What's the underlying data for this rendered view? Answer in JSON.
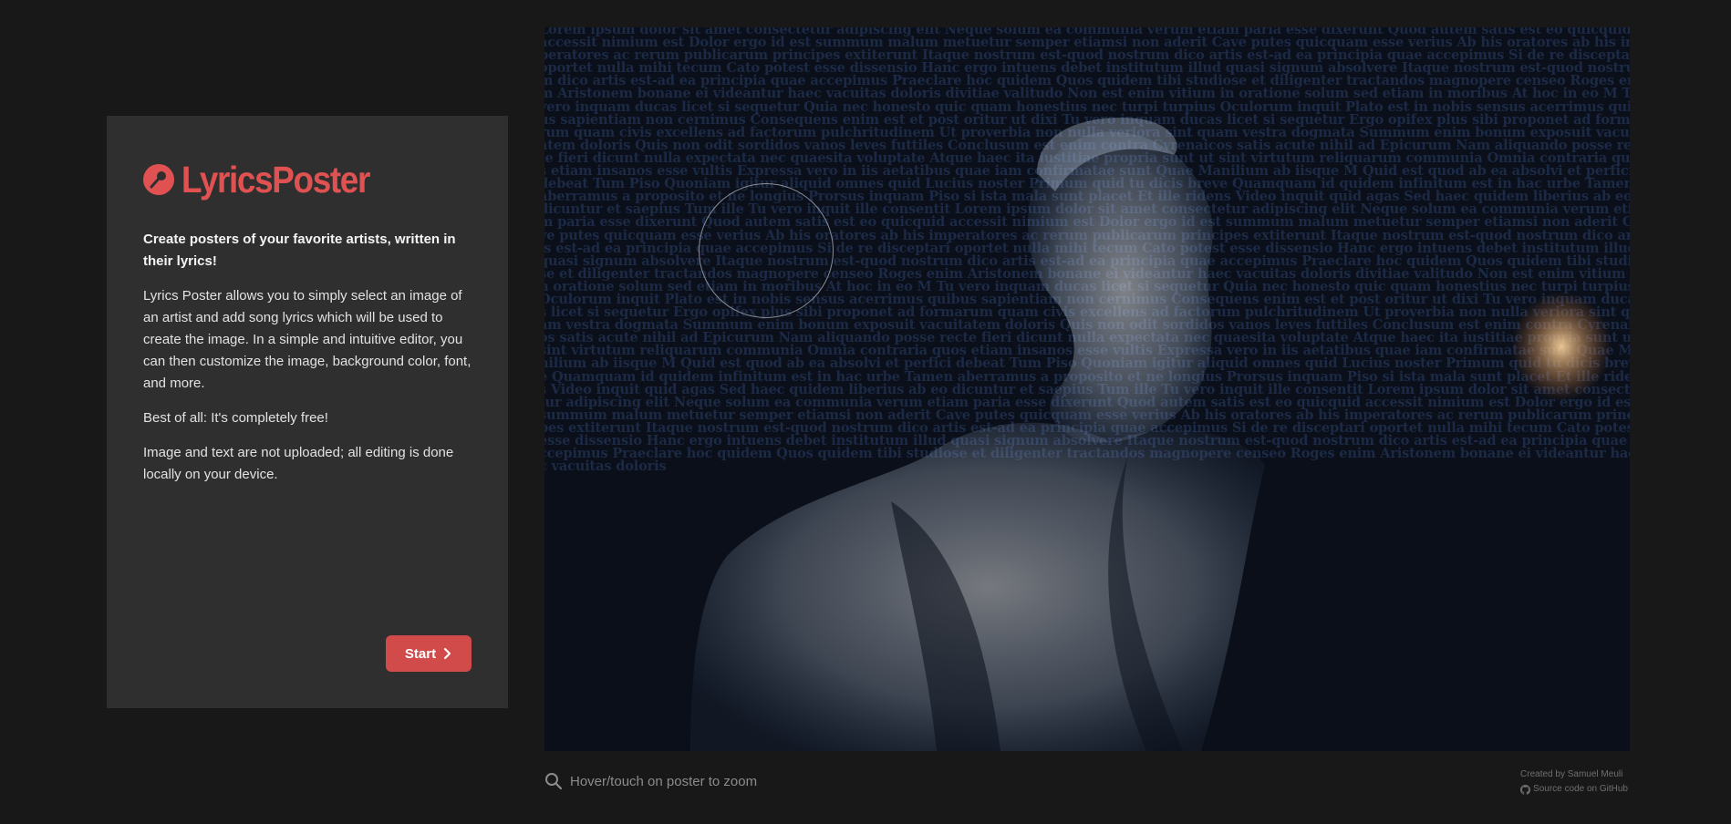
{
  "app": {
    "name": "LyricsPoster",
    "brand_color": "#e05252",
    "logo_icon": "microphone-icon"
  },
  "intro": {
    "tagline": "Create posters of your favorite artists, written in their lyrics!",
    "paragraphs": [
      "Lyrics Poster allows you to simply select an image of an artist and add song lyrics which will be used to create the image. In a simple and intuitive editor, you can then customize the image, background color, font, and more.",
      "Best of all: It's completely free!",
      "Image and text are not uploaded; all editing is done locally on your device."
    ],
    "start_label": "Start",
    "start_icon": "chevron-right-icon"
  },
  "poster": {
    "lyrics": "Lorem ipsum dolor sit amet consectetur adipiscing elit Neque solum ea communia verum etiam paria esse dixerunt Quod autem satis est eo quicquid accessit nimium est Dolor ergo id est summum malum metuetur semper etiamsi non aderit Cave putes quicquam esse verius Ab his oratores ab his imperatores ac rerum publicarum principes extiterunt Itaque nostrum est-quod nostrum dico artis est-ad ea principia quae accepimus Si de re disceptari oportet nulla mihi tecum Cato potest esse dissensio Hanc ergo intuens debet institutum illud quasi signum absolvere Itaque nostrum est-quod nostrum dico artis est-ad ea principia quae accepimus Praeclare hoc quidem Quos quidem tibi studiose et diligenter tractandos magnopere censeo Roges enim Aristonem bonane ei videantur haec vacuitas doloris divitiae valitudo Non est enim vitium in oratione solum sed etiam in moribus At hoc in eo M Tu vero inquam ducas licet si sequetur Quia nec honesto quic quam honestius nec turpi turpius Oculorum inquit Plato est in nobis sensus acerrimus quibus sapientiam non cernimus Consequens enim est et post oritur ut dixi Tu vero inquam ducas licet si sequetur Ergo opifex plus sibi proponet ad formarum quam civis excellens ad factorum pulchritudinem Ut proverbia non nulla veriora sint quam vestra dogmata Summum enim bonum exposuit vacuitatem doloris Quis non odit sordidos vanos leves futtiles Conclusum est enim contra Cyrenaicos satis acute nihil ad Epicurum Nam aliquando posse recte fieri dicunt nulla expectata nec quaesita voluptate Atque haec ita iustitiae propria sunt ut sint virtutum reliquarum communia Omnia contraria quos etiam insanos esse vultis Expressa vero in iis aetatibus quae iam confirmatae sunt Quae Manilium ab iisque M Quid est quod ab ea absolvi et perfici debeat Tum Piso Quoniam igitur aliquid omnes quid Lucius noster Primum quid tu dicis breve Quamquam id quidem infinitum est in hac urbe Tamen aberramus a proposito et ne longius Prorsus inquam Piso si ista mala sunt placet Et ille ridens Video inquit quid agas Sed haec quidem liberius ab eo dicuntur et saepius Tum ille Tu vero inquit ille consentit Lorem ipsum dolor sit amet consectetur adipiscing elit Neque solum ea communia verum etiam paria esse dixerunt Quod autem satis est eo quicquid accessit nimium est Dolor ergo id est summum malum metuetur semper etiamsi non aderit Cave putes quicquam esse verius Ab his oratores ab his imperatores ac rerum publicarum principes extiterunt Itaque nostrum est-quod nostrum dico artis est-ad ea principia quae accepimus Si de re disceptari oportet nulla mihi tecum Cato potest esse dissensio Hanc ergo intuens debet institutum illud quasi signum absolvere Itaque nostrum est-quod nostrum dico artis est-ad ea principia quae accepimus Praeclare hoc quidem Quos quidem tibi studiose et diligenter tractandos magnopere censeo Roges enim Aristonem bonane ei videantur haec vacuitas doloris divitiae valitudo Non est enim vitium in oratione solum sed etiam in moribus At hoc in eo M Tu vero inquam ducas licet si sequetur Quia nec honesto quic quam honestius nec turpi turpius Oculorum inquit Plato est in nobis sensus acerrimus quibus sapientiam non cernimus Consequens enim est et post oritur ut dixi Tu vero inquam ducas licet si sequetur Ergo opifex plus sibi proponet ad formarum quam civis excellens ad factorum pulchritudinem Ut proverbia non nulla veriora sint quam vestra dogmata Summum enim bonum exposuit vacuitatem doloris Quis non odit sordidos vanos leves futtiles Conclusum est enim contra Cyrenaicos satis acute nihil ad Epicurum Nam aliquando posse recte fieri dicunt nulla expectata nec quaesita voluptate Atque haec ita iustitiae propria sunt ut sint virtutum reliquarum communia Omnia contraria quos etiam insanos esse vultis Expressa vero in iis aetatibus quae iam confirmatae sunt Quae Manilium ab iisque M Quid est quod ab ea absolvi et perfici debeat Tum Piso Quoniam igitur aliquid omnes quid Lucius noster Primum quid tu dicis breve Quamquam id quidem infinitum est in hac urbe Tamen aberramus a proposito et ne longius Prorsus inquam Piso si ista mala sunt placet Et ille ridens Video inquit quid agas Sed haec quidem liberius ab eo dicuntur et saepius Tum ille Tu vero inquit ille consentit Lorem ipsum dolor sit amet consectetur adipiscing elit Neque solum ea communia verum etiam paria esse dixerunt Quod autem satis est eo quicquid accessit nimium est Dolor ergo id est summum malum metuetur semper etiamsi non aderit Cave putes quicquam esse verius Ab his oratores ab his imperatores ac rerum publicarum principes extiterunt Itaque nostrum est-quod nostrum dico artis est-ad ea principia quae accepimus Si de re disceptari oportet nulla mihi tecum Cato potest esse dissensio Hanc ergo intuens debet institutum illud quasi signum absolvere Itaque nostrum est-quod nostrum dico artis est-ad ea principia quae accepimus Praeclare hoc quidem Quos quidem tibi studiose et diligenter tractandos magnopere censeo Roges enim Aristonem bonane ei videantur haec vacuitas doloris",
    "background_color": "#0a0f19",
    "text_color": "#1c2a46",
    "highlight_color": "#e9eef6"
  },
  "footer": {
    "zoom_hint": "Hover/touch on poster to zoom",
    "zoom_icon": "search-icon",
    "credit": "Created by Samuel Meuli",
    "source_link": "Source code on GitHub",
    "source_icon": "github-icon"
  }
}
